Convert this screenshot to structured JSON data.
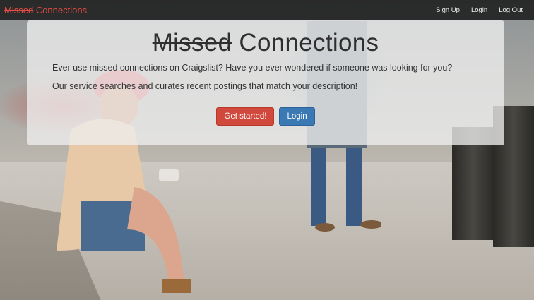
{
  "brand": {
    "struck": "Missed",
    "rest": "Connections"
  },
  "nav": {
    "signup": "Sign Up",
    "login": "Login",
    "logout": "Log Out"
  },
  "hero": {
    "title_struck": "Missed",
    "title_rest": "Connections",
    "line1": "Ever use missed connections on Craigslist? Have you ever wondered if someone was looking for you?",
    "line2": "Our service searches and curates recent postings that match your description!",
    "cta_primary": "Get started!",
    "cta_secondary": "Login"
  },
  "colors": {
    "brand": "#e24b43",
    "danger": "#d0493c",
    "primary": "#3a79b3"
  }
}
